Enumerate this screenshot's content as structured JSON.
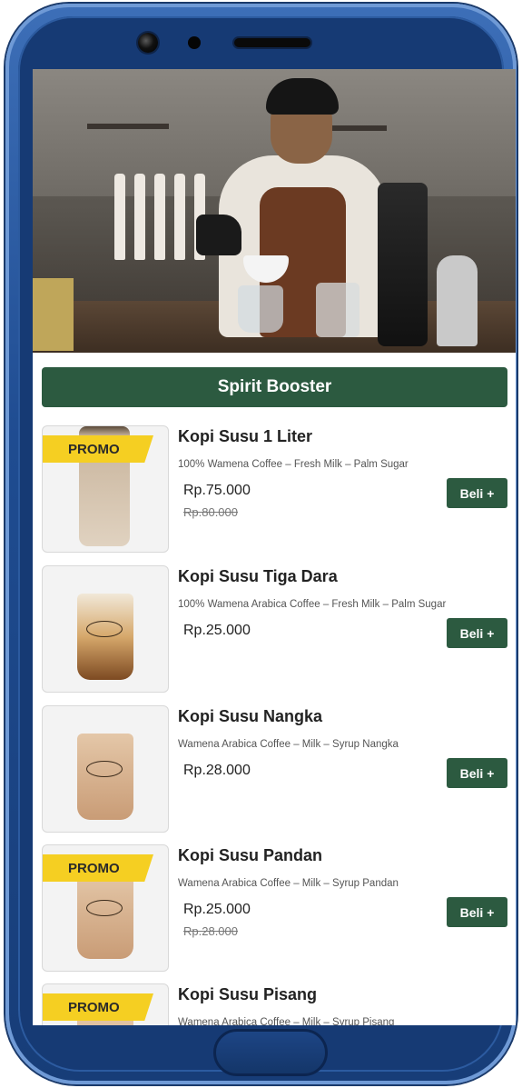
{
  "category": {
    "title": "Spirit Booster"
  },
  "products": [
    {
      "name": "Kopi Susu 1 Liter",
      "description": "100% Wamena Coffee – Fresh Milk – Palm Sugar",
      "price": "Rp.75.000",
      "old_price": "Rp.80.000",
      "promo": "PROMO",
      "buy_label": "Beli +"
    },
    {
      "name": "Kopi Susu Tiga Dara",
      "description": "100% Wamena Arabica Coffee – Fresh Milk – Palm Sugar",
      "price": "Rp.25.000",
      "buy_label": "Beli +"
    },
    {
      "name": "Kopi Susu Nangka",
      "description": "Wamena Arabica Coffee – Milk – Syrup Nangka",
      "price": "Rp.28.000",
      "buy_label": "Beli +"
    },
    {
      "name": "Kopi Susu Pandan",
      "description": "Wamena Arabica Coffee – Milk – Syrup Pandan",
      "price": "Rp.25.000",
      "old_price": "Rp.28.000",
      "promo": "PROMO",
      "buy_label": "Beli +"
    },
    {
      "name": "Kopi Susu Pisang",
      "description": "Wamena Arabica Coffee – Milk – Syrup Pisang",
      "promo": "PROMO"
    }
  ],
  "colors": {
    "accent_green": "#2c5a40",
    "promo_yellow": "#f5cf22",
    "phone_frame": "#1f4c91"
  }
}
